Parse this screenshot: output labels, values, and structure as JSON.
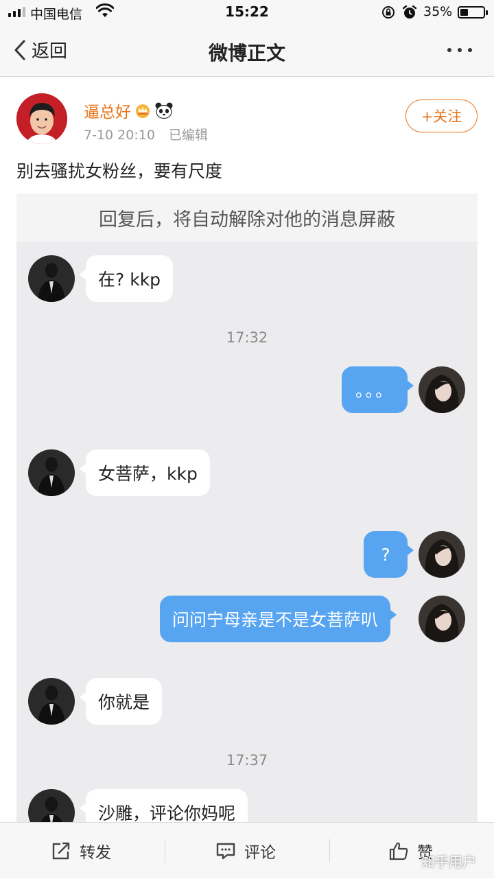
{
  "status_bar": {
    "carrier": "中国电信",
    "time": "15:22",
    "battery": "35%",
    "battery_level": 0.35
  },
  "nav": {
    "back_label": "返回",
    "title": "微博正文"
  },
  "post": {
    "username": "逼总好",
    "time": "7-10 20:10",
    "edited": "已编辑",
    "follow_label": "+关注",
    "text": "别去骚扰女粉丝，要有尺度"
  },
  "screenshot": {
    "banner": "回复后，将自动解除对他的消息屏蔽",
    "messages": [
      {
        "side": "left",
        "text": "在? kkp"
      },
      {
        "side": "time",
        "text": "17:32"
      },
      {
        "side": "right",
        "text": "。。。"
      },
      {
        "side": "left",
        "text": "女菩萨，kkp"
      },
      {
        "side": "right",
        "text": "?"
      },
      {
        "side": "right",
        "text": "问问宁母亲是不是女菩萨叭"
      },
      {
        "side": "left",
        "text": "你就是"
      },
      {
        "side": "time",
        "text": "17:37"
      },
      {
        "side": "left",
        "text": "沙雕，评论你妈呢"
      }
    ]
  },
  "bottom_bar": {
    "repost": "转发",
    "comment": "评论",
    "like": "赞"
  },
  "watermark": "知乎用户",
  "colors": {
    "accent": "#e8751a",
    "bubble_blue": "#57a4f0"
  }
}
